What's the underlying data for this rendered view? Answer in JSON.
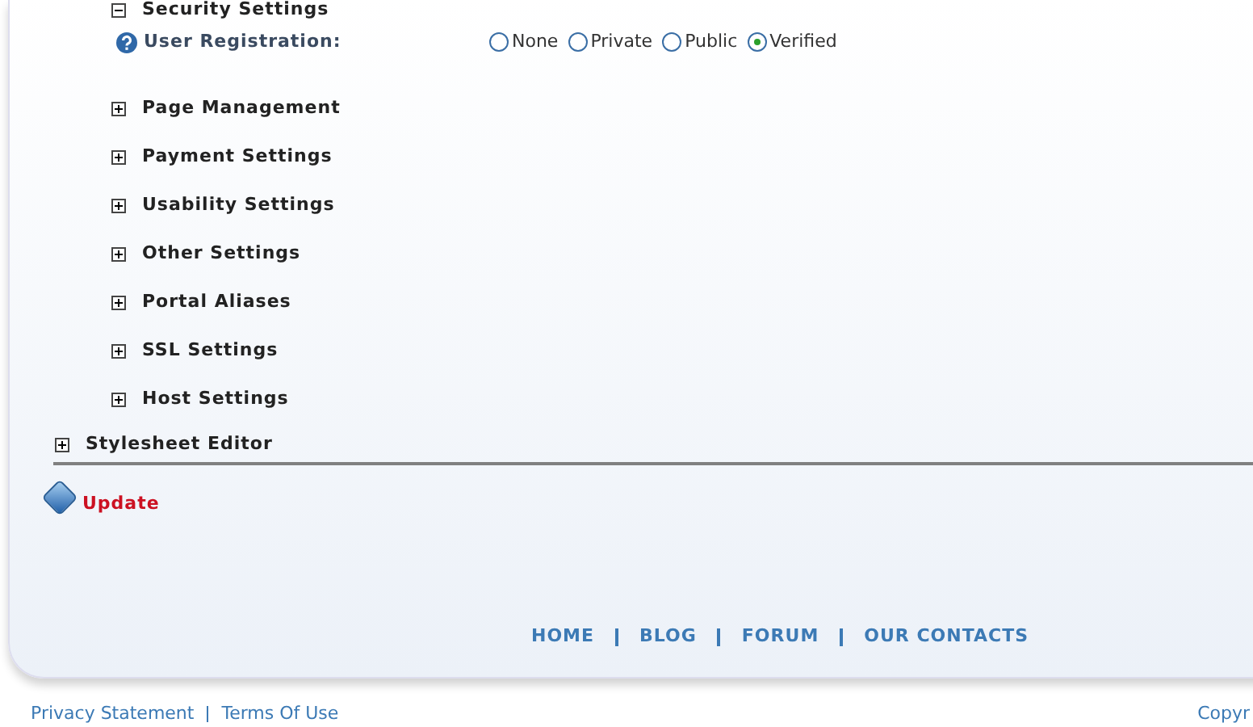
{
  "security_section": {
    "label": "Security Settings",
    "expanded": true
  },
  "user_registration": {
    "label": "User Registration:",
    "options": [
      {
        "label": "None",
        "selected": false
      },
      {
        "label": "Private",
        "selected": false
      },
      {
        "label": "Public",
        "selected": false
      },
      {
        "label": "Verified",
        "selected": true
      }
    ]
  },
  "sections": [
    {
      "label": "Page Management",
      "expanded": false
    },
    {
      "label": "Payment Settings",
      "expanded": false
    },
    {
      "label": "Usability Settings",
      "expanded": false
    },
    {
      "label": "Other Settings",
      "expanded": false
    },
    {
      "label": "Portal Aliases",
      "expanded": false
    },
    {
      "label": "SSL Settings",
      "expanded": false
    },
    {
      "label": "Host Settings",
      "expanded": false
    }
  ],
  "stylesheet_section": {
    "label": "Stylesheet Editor",
    "expanded": false
  },
  "update_button": "Update",
  "footer_nav": [
    "HOME",
    "BLOG",
    "FORUM",
    "OUR CONTACTS"
  ],
  "footer_links": [
    "Privacy Statement",
    "Terms Of Use"
  ],
  "copyright": "Copyr"
}
